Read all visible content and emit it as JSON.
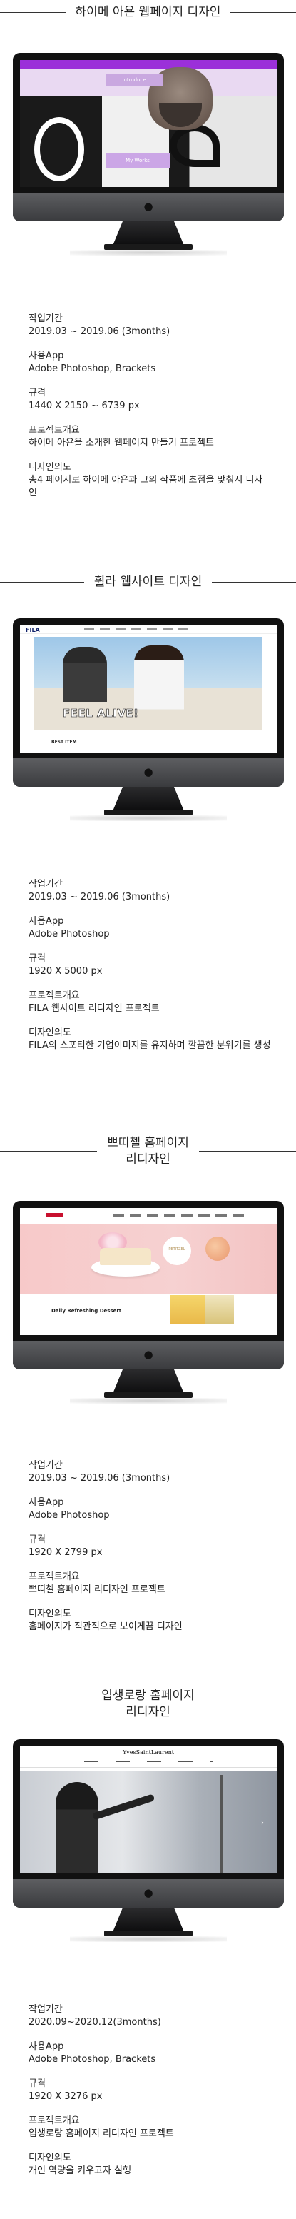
{
  "projects": [
    {
      "heading": "하이메 아욘 웹페이지 디자인",
      "screen": {
        "button_label": "Introduce",
        "bar_label": "My Works"
      },
      "details": [
        {
          "label": "작업기간",
          "value": "2019.03 ~ 2019.06 (3months)"
        },
        {
          "label": "사용App",
          "value": "Adobe Photoshop, Brackets"
        },
        {
          "label": "규격",
          "value": "1440 X 2150 ~ 6739 px"
        },
        {
          "label": "프로젝트개요",
          "value": "하이메 아욘을 소개한 웹페이지 만들기 프로젝트"
        },
        {
          "label": "디자인의도",
          "value": "총4 페이지로 하이메 아욘과 그의 작품에 초점을 맞춰서 디자인"
        }
      ]
    },
    {
      "heading": "휠라 웹사이트 디자인",
      "screen": {
        "logo": "FILA",
        "hero_text": "FEEL ALIVE!",
        "section_label": "BEST ITEM"
      },
      "details": [
        {
          "label": "작업기간",
          "value": "2019.03 ~ 2019.06 (3months)"
        },
        {
          "label": "사용App",
          "value": "Adobe Photoshop"
        },
        {
          "label": "규격",
          "value": "1920 X 5000 px"
        },
        {
          "label": "프로젝트개요",
          "value": "FILA 웹사이트 리디자인 프로젝트"
        },
        {
          "label": "디자인의도",
          "value": "FILA의 스포티한 기업이미지를 유지하며 깔끔한 분위기를 생성"
        }
      ]
    },
    {
      "heading": "쁘띠첼 홈페이지\n리디자인",
      "screen": {
        "badge": "PETITZEL",
        "section_label": "Daily Refreshing Dessert"
      },
      "details": [
        {
          "label": "작업기간",
          "value": "2019.03 ~ 2019.06 (3months)"
        },
        {
          "label": "사용App",
          "value": "Adobe Photoshop"
        },
        {
          "label": "규격",
          "value": "1920 X 2799 px"
        },
        {
          "label": "프로젝트개요",
          "value": "쁘띠첼 홈페이지 리디자인 프로젝트"
        },
        {
          "label": "디자인의도",
          "value": "홈페이지가 직관적으로 보이게끔 디자인"
        }
      ]
    },
    {
      "heading": "입생로랑 홈페이지\n리디자인",
      "screen": {
        "logo": "YvesSaintLaurent"
      },
      "details": [
        {
          "label": "작업기간",
          "value": "2020.09~2020.12(3months)"
        },
        {
          "label": "사용App",
          "value": "Adobe Photoshop, Brackets"
        },
        {
          "label": "규격",
          "value": "1920 X 3276 px"
        },
        {
          "label": "프로젝트개요",
          "value": "입생로랑 홈페이지 리디자인 프로젝트"
        },
        {
          "label": "디자인의도",
          "value": "개인 역량을 키우고자 실행"
        }
      ]
    }
  ],
  "icons": {
    "apple": "apple-logo-icon"
  }
}
